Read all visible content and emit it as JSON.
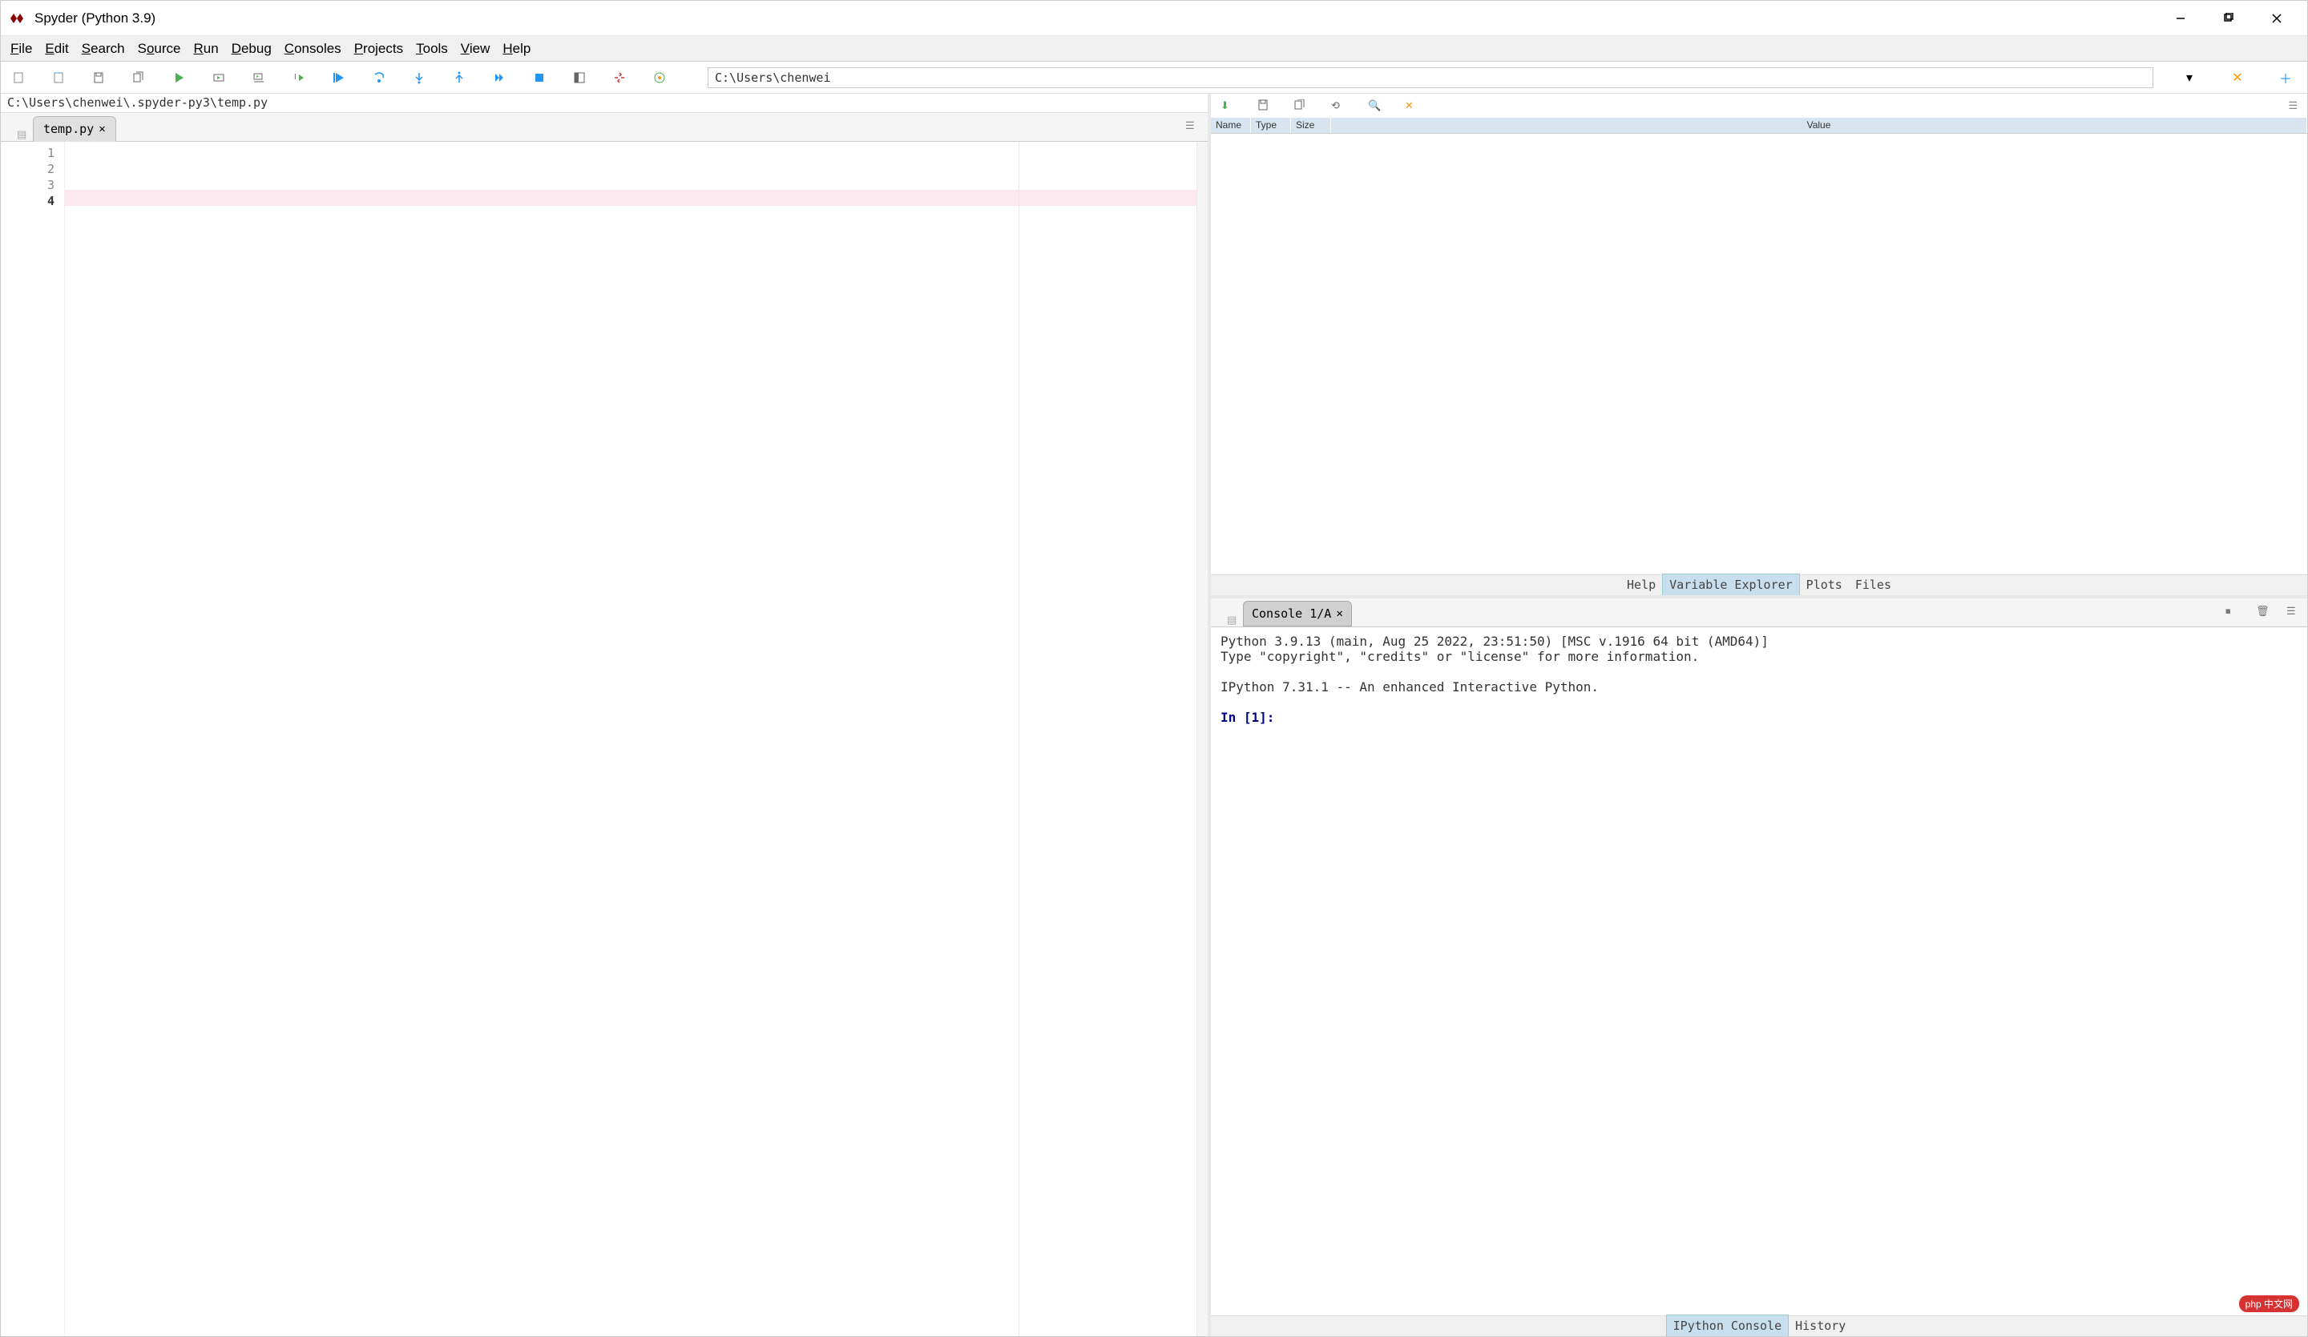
{
  "titlebar": {
    "title": "Spyder (Python 3.9)",
    "icon_label": "Spyder"
  },
  "menubar": {
    "items": [
      {
        "label": "File",
        "ul": "F"
      },
      {
        "label": "Edit",
        "ul": "E"
      },
      {
        "label": "Search",
        "ul": "S"
      },
      {
        "label": "Source",
        "ul": "o"
      },
      {
        "label": "Run",
        "ul": "R"
      },
      {
        "label": "Debug",
        "ul": "D"
      },
      {
        "label": "Consoles",
        "ul": "C"
      },
      {
        "label": "Projects",
        "ul": "P"
      },
      {
        "label": "Tools",
        "ul": "T"
      },
      {
        "label": "View",
        "ul": "V"
      },
      {
        "label": "Help",
        "ul": "H"
      }
    ]
  },
  "toolbar": {
    "working_dir": "C:\\Users\\chenwei"
  },
  "editor": {
    "filepath": "C:\\Users\\chenwei\\.spyder-py3\\temp.py",
    "tab_label": "temp.py",
    "line_numbers": [
      "1",
      "2",
      "3",
      "4"
    ],
    "active_line": 4
  },
  "variable_explorer": {
    "headers": {
      "name": "Name",
      "type": "Type",
      "size": "Size",
      "value": "Value"
    },
    "bottom_tabs": {
      "help": "Help",
      "variable_explorer": "Variable Explorer",
      "plots": "Plots",
      "files": "Files"
    }
  },
  "console": {
    "tab_label": "Console 1/A",
    "output_line1": "Python 3.9.13 (main, Aug 25 2022, 23:51:50) [MSC v.1916 64 bit (AMD64)]",
    "output_line2": "Type \"copyright\", \"credits\" or \"license\" for more information.",
    "output_line3": "IPython 7.31.1 -- An enhanced Interactive Python.",
    "prompt": "In [1]:",
    "bottom_tabs": {
      "ipython_console": "IPython Console",
      "history": "History"
    }
  },
  "watermark": "php 中文网"
}
